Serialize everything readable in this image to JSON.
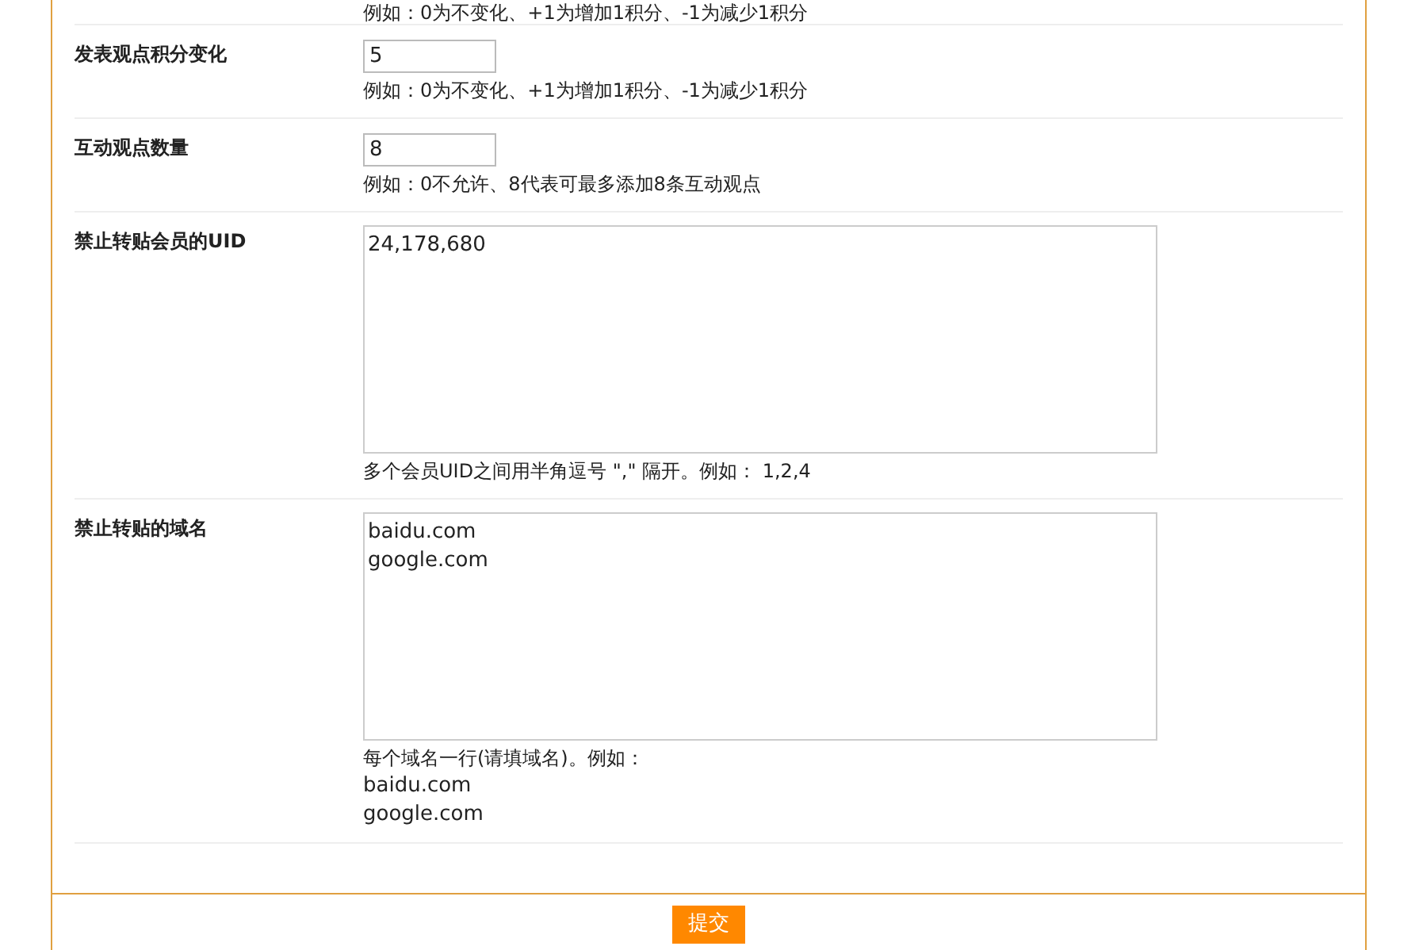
{
  "top_hint": "例如：0为不变化、+1为增加1积分、-1为减少1积分",
  "fields": [
    {
      "kind": "input",
      "label": "发表观点积分变化",
      "value": "5",
      "hints": [
        "例如：0为不变化、+1为增加1积分、-1为减少1积分"
      ]
    },
    {
      "kind": "input",
      "label": "互动观点数量",
      "value": "8",
      "hints": [
        "例如：0不允许、8代表可最多添加8条互动观点"
      ]
    },
    {
      "kind": "textarea",
      "label": "禁止转贴会员的UID",
      "value": "24,178,680",
      "hints": [
        "多个会员UID之间用半角逗号 \",\" 隔开。例如： 1,2,4"
      ]
    },
    {
      "kind": "textarea",
      "label": "禁止转贴的域名",
      "value": "baidu.com\ngoogle.com",
      "hints": [
        "每个域名一行(请填域名)。例如：",
        "baidu.com",
        "google.com"
      ]
    }
  ],
  "submit": "提交"
}
